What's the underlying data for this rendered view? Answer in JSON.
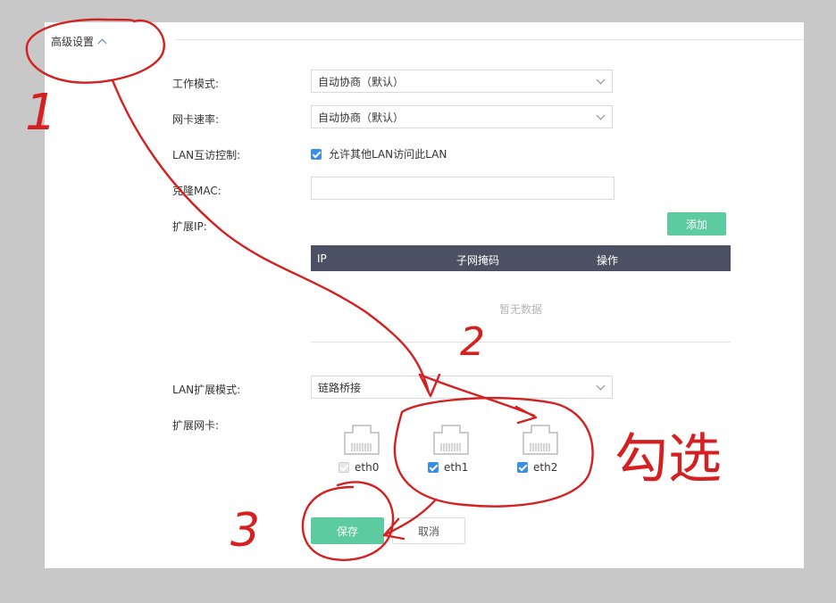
{
  "section": {
    "title": "高级设置"
  },
  "form": {
    "work_mode": {
      "label": "工作模式:",
      "value": "自动协商（默认）"
    },
    "nic_speed": {
      "label": "网卡速率:",
      "value": "自动协商（默认）"
    },
    "lan_access": {
      "label": "LAN互访控制:",
      "checkbox_label": "允许其他LAN访问此LAN",
      "checked": true
    },
    "clone_mac": {
      "label": "克隆MAC:",
      "value": ""
    },
    "ext_ip": {
      "label": "扩展IP:",
      "add_button": "添加"
    },
    "table": {
      "columns": [
        "IP",
        "子网掩码",
        "操作"
      ],
      "empty_text": "暂无数据"
    },
    "lan_ext_mode": {
      "label": "LAN扩展模式:",
      "value": "链路桥接"
    },
    "ext_nic": {
      "label": "扩展网卡:",
      "items": [
        {
          "name": "eth0",
          "checked": true,
          "disabled": true
        },
        {
          "name": "eth1",
          "checked": true,
          "disabled": false
        },
        {
          "name": "eth2",
          "checked": true,
          "disabled": false
        }
      ]
    }
  },
  "actions": {
    "save": "保存",
    "cancel": "取消"
  },
  "annotations": {
    "step1": "1",
    "step2": "2",
    "step3": "3",
    "note": "勾选"
  },
  "colors": {
    "accent_green": "#5ccba0",
    "table_header": "#4b5163",
    "checkbox_blue": "#3a8ee6",
    "annotation_red": "#d42020"
  }
}
